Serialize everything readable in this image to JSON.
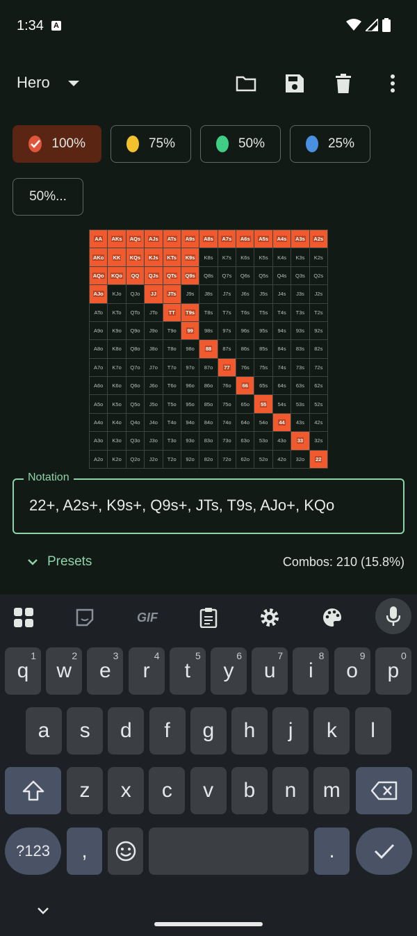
{
  "status": {
    "time": "1:34",
    "badge": "A"
  },
  "appbar": {
    "title": "Hero"
  },
  "chips": [
    {
      "label": "100%",
      "color": "#e0553b",
      "selected": true
    },
    {
      "label": "75%",
      "color": "#f2c12e",
      "selected": false
    },
    {
      "label": "50%",
      "color": "#3ecf85",
      "selected": false
    },
    {
      "label": "25%",
      "color": "#4a90e2",
      "selected": false
    }
  ],
  "chip_extra": "50%...",
  "grid": {
    "rows": [
      [
        "AA",
        "AKs",
        "AQs",
        "AJs",
        "ATs",
        "A9s",
        "A8s",
        "A7s",
        "A6s",
        "A5s",
        "A4s",
        "A3s",
        "A2s"
      ],
      [
        "AKo",
        "KK",
        "KQs",
        "KJs",
        "KTs",
        "K9s",
        "K8s",
        "K7s",
        "K6s",
        "K5s",
        "K4s",
        "K3s",
        "K2s"
      ],
      [
        "AQo",
        "KQo",
        "QQ",
        "QJs",
        "QTs",
        "Q9s",
        "Q8s",
        "Q7s",
        "Q6s",
        "Q5s",
        "Q4s",
        "Q3s",
        "Q2s"
      ],
      [
        "AJo",
        "KJo",
        "QJo",
        "JJ",
        "JTs",
        "J9s",
        "J8s",
        "J7s",
        "J6s",
        "J5s",
        "J4s",
        "J3s",
        "J2s"
      ],
      [
        "ATo",
        "KTo",
        "QTo",
        "JTo",
        "TT",
        "T9s",
        "T8s",
        "T7s",
        "T6s",
        "T5s",
        "T4s",
        "T3s",
        "T2s"
      ],
      [
        "A9o",
        "K9o",
        "Q9o",
        "J9o",
        "T9o",
        "99",
        "98s",
        "97s",
        "96s",
        "95s",
        "94s",
        "93s",
        "92s"
      ],
      [
        "A8o",
        "K8o",
        "Q8o",
        "J8o",
        "T8o",
        "98o",
        "88",
        "87s",
        "86s",
        "85s",
        "84s",
        "83s",
        "82s"
      ],
      [
        "A7o",
        "K7o",
        "Q7o",
        "J7o",
        "T7o",
        "97o",
        "87o",
        "77",
        "76s",
        "75s",
        "74s",
        "73s",
        "72s"
      ],
      [
        "A6o",
        "K6o",
        "Q6o",
        "J6o",
        "T6o",
        "96o",
        "86o",
        "76o",
        "66",
        "65s",
        "64s",
        "63s",
        "62s"
      ],
      [
        "A5o",
        "K5o",
        "Q5o",
        "J5o",
        "T5o",
        "95o",
        "85o",
        "75o",
        "65o",
        "55",
        "54s",
        "53s",
        "52s"
      ],
      [
        "A4o",
        "K4o",
        "Q4o",
        "J4o",
        "T4o",
        "94o",
        "84o",
        "74o",
        "64o",
        "54o",
        "44",
        "43s",
        "42s"
      ],
      [
        "A3o",
        "K3o",
        "Q3o",
        "J3o",
        "T3o",
        "93o",
        "83o",
        "73o",
        "63o",
        "53o",
        "43o",
        "33",
        "32s"
      ],
      [
        "A2o",
        "K2o",
        "Q2o",
        "J2o",
        "T2o",
        "92o",
        "82o",
        "72o",
        "62o",
        "52o",
        "42o",
        "32o",
        "22"
      ]
    ],
    "selected": [
      "AA",
      "AKs",
      "AQs",
      "AJs",
      "ATs",
      "A9s",
      "A8s",
      "A7s",
      "A6s",
      "A5s",
      "A4s",
      "A3s",
      "A2s",
      "AKo",
      "KK",
      "KQs",
      "KJs",
      "KTs",
      "K9s",
      "AQo",
      "KQo",
      "QQ",
      "QJs",
      "QTs",
      "Q9s",
      "AJo",
      "JJ",
      "JTs",
      "TT",
      "T9s",
      "99",
      "88",
      "77",
      "66",
      "55",
      "44",
      "33",
      "22"
    ]
  },
  "notation": {
    "label": "Notation",
    "value": "22+, A2s+, K9s+, Q9s+, JTs, T9s, AJo+, KQo"
  },
  "presets": {
    "label": "Presets"
  },
  "combos": "Combos: 210 (15.8%)",
  "keyboard": {
    "row1": [
      [
        "q",
        "1"
      ],
      [
        "w",
        "2"
      ],
      [
        "e",
        "3"
      ],
      [
        "r",
        "4"
      ],
      [
        "t",
        "5"
      ],
      [
        "y",
        "6"
      ],
      [
        "u",
        "7"
      ],
      [
        "i",
        "8"
      ],
      [
        "o",
        "9"
      ],
      [
        "p",
        "0"
      ]
    ],
    "row2": [
      "a",
      "s",
      "d",
      "f",
      "g",
      "h",
      "j",
      "k",
      "l"
    ],
    "row3": [
      "z",
      "x",
      "c",
      "v",
      "b",
      "n",
      "m"
    ],
    "sym": "?123",
    "comma": ",",
    "period": ".",
    "gif": "GIF"
  }
}
